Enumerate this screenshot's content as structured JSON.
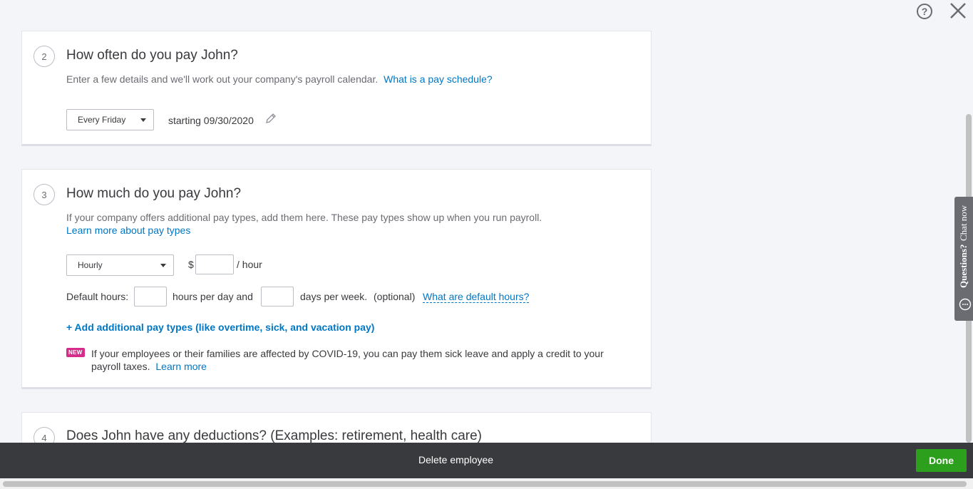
{
  "toolbar": {
    "help_icon": "?",
    "close_icon": "close-icon"
  },
  "pay_schedule": {
    "step": "2",
    "title": "How often do you pay John?",
    "description": "Enter a few details and we'll work out your company's payroll calendar.",
    "link": "What is a pay schedule?",
    "frequency": "Every Friday",
    "starting": "starting 09/30/2020"
  },
  "pay_rate": {
    "step": "3",
    "title": "How much do you pay John?",
    "description": "If your company offers additional pay types, add them here. These pay types show up when you run payroll.",
    "learn_link": "Learn more about pay types",
    "pay_type": "Hourly",
    "currency": "$",
    "per_unit": "/ hour",
    "default_hours_label": "Default hours:",
    "hours_per_day_label": "hours per day and",
    "days_per_week_label": "days per week.",
    "optional": "(optional)",
    "default_hours_link": "What are default hours?",
    "add_pay_types": "+ Add additional pay types (like overtime, sick, and vacation pay)",
    "badge": "NEW",
    "covid_text": "If your employees or their families are affected by COVID-19, you can pay them sick leave and apply a credit to your payroll taxes.",
    "covid_link": "Learn more"
  },
  "deductions": {
    "step": "4",
    "title": "Does John have any deductions? (Examples: retirement, health care)"
  },
  "chat": {
    "question": "Questions?",
    "chat": "Chat now"
  },
  "footer": {
    "delete": "Delete employee",
    "done": "Done"
  },
  "colors": {
    "link": "#0077c5",
    "done": "#2ca01c",
    "footer": "#393a3d",
    "badge": "#d52b8a"
  }
}
